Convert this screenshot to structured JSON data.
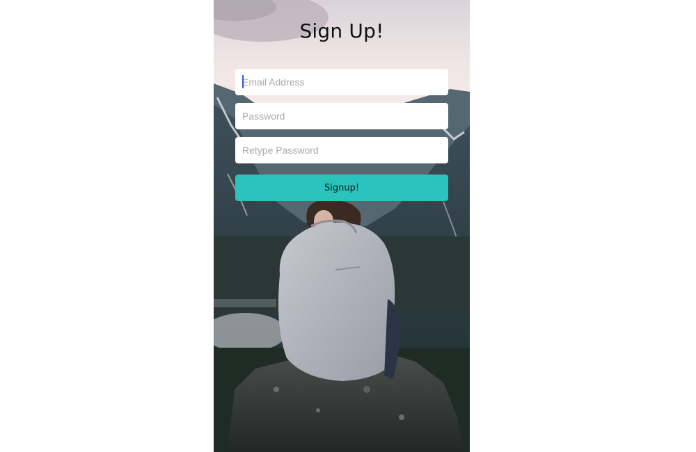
{
  "signup": {
    "title": "Sign Up!",
    "email_placeholder": "Email Address",
    "email_value": "",
    "password_placeholder": "Password",
    "password_value": "",
    "retype_placeholder": "Retype Password",
    "retype_value": "",
    "submit_label": "Signup!"
  },
  "colors": {
    "button": "#2cc3bd",
    "caret": "#2a5bd7"
  },
  "background": {
    "icon": "mountain-lake-photo-background"
  }
}
